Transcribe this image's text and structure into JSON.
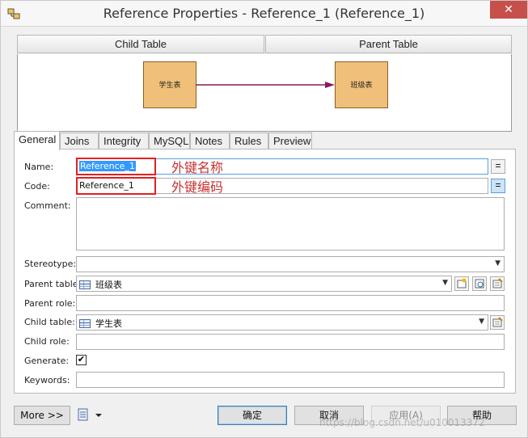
{
  "window": {
    "title": "Reference Properties - Reference_1 (Reference_1)",
    "close_glyph": "✕"
  },
  "diagram": {
    "child_tab": "Child Table",
    "parent_tab": "Parent Table",
    "child_box": "学生表",
    "parent_box": "班级表",
    "box_color": "#f0c07a",
    "link_color": "#8b1a5a"
  },
  "tabs": [
    "General",
    "Joins",
    "Integrity",
    "MySQL",
    "Notes",
    "Rules",
    "Preview"
  ],
  "form": {
    "name_label": "Name:",
    "name_value": "Reference_1",
    "code_label": "Code:",
    "code_value": "Reference_1",
    "comment_label": "Comment:",
    "comment_value": "",
    "stereotype_label": "Stereotype:",
    "stereotype_value": "",
    "parent_table_label": "Parent table:",
    "parent_table_value": "班级表",
    "parent_role_label": "Parent role:",
    "parent_role_value": "",
    "child_table_label": "Child table:",
    "child_table_value": "学生表",
    "child_role_label": "Child role:",
    "child_role_value": "",
    "generate_label": "Generate:",
    "generate_checked": true,
    "check_glyph": "✔",
    "keywords_label": "Keywords:",
    "keywords_value": "",
    "equals_glyph": "="
  },
  "annotations": {
    "name_note": "外键名称",
    "code_note": "外键编码",
    "color": "#c83232"
  },
  "buttons": {
    "more": "More >>",
    "ok": "确定",
    "cancel": "取消",
    "apply": "应用(A)",
    "help": "帮助"
  },
  "watermark": "https://blog.csdn.net/u010013372"
}
